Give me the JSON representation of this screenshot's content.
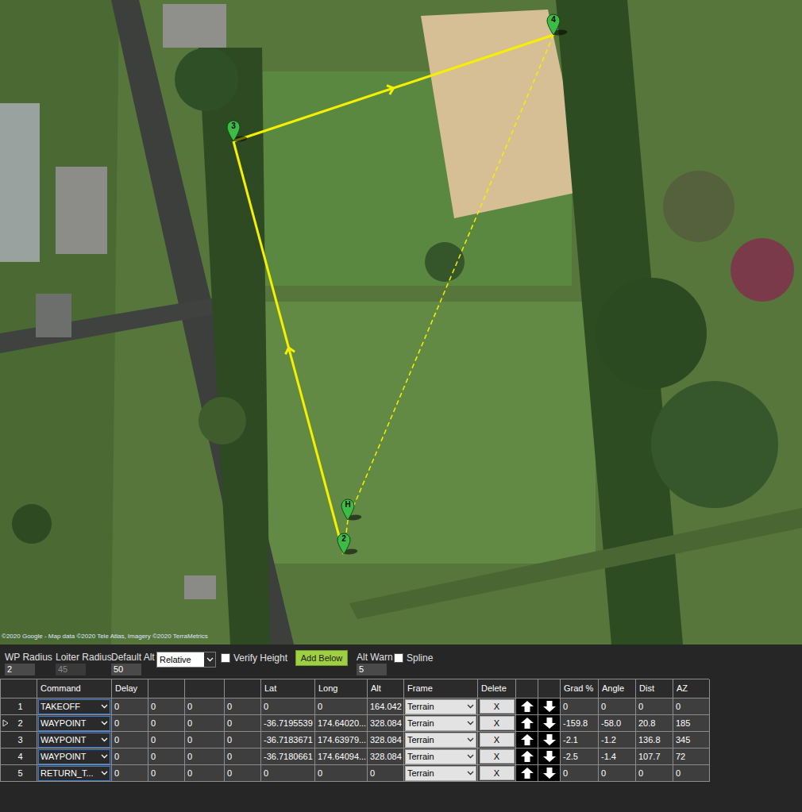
{
  "map": {
    "attribution": "©2020 Google - Map data ©2020 Tele Atlas, Imagery ©2020 TerraMetrics",
    "waypoints": [
      {
        "label": "H"
      },
      {
        "label": "2"
      },
      {
        "label": "3"
      },
      {
        "label": "4"
      }
    ],
    "route": [
      {
        "from": "2",
        "to": "3",
        "kind": "solid"
      },
      {
        "from": "3",
        "to": "4",
        "kind": "solid"
      },
      {
        "from": "4",
        "to": "H",
        "kind": "dashed"
      },
      {
        "from": "H",
        "to": "2",
        "kind": "dashed"
      }
    ]
  },
  "controls": {
    "wp_radius": {
      "label": "WP Radius",
      "value": "2",
      "disabled": false
    },
    "loiter_radius": {
      "label": "Loiter Radius",
      "value": "45",
      "disabled": true
    },
    "default_alt": {
      "label": "Default Alt",
      "value": "50",
      "disabled": false
    },
    "alt_frame": {
      "value": "Relative"
    },
    "verify_height": {
      "label": "Verify Height",
      "checked": false
    },
    "add_below": "Add Below",
    "alt_warn": {
      "label": "Alt Warn",
      "value": "5",
      "disabled": false
    },
    "spline": {
      "label": "Spline",
      "checked": false
    }
  },
  "table": {
    "columns": [
      "",
      "Command",
      "Delay",
      "",
      "",
      "",
      "Lat",
      "Long",
      "Alt",
      "Frame",
      "Delete",
      "",
      "",
      "Grad %",
      "Angle",
      "Dist",
      "AZ"
    ],
    "rows": [
      {
        "num": "1",
        "current": false,
        "cells": [
          "TAKEOFF",
          "0",
          "0",
          "0",
          "0",
          "0",
          "0",
          "164.042",
          "Terrain",
          "X",
          "0",
          "0",
          "0",
          "0"
        ]
      },
      {
        "num": "2",
        "current": true,
        "cells": [
          "WAYPOINT",
          "0",
          "0",
          "0",
          "0",
          "-36.7195539",
          "174.64020...",
          "328.084",
          "Terrain",
          "X",
          "-159.8",
          "-58.0",
          "20.8",
          "185"
        ]
      },
      {
        "num": "3",
        "current": false,
        "cells": [
          "WAYPOINT",
          "0",
          "0",
          "0",
          "0",
          "-36.7183671",
          "174.63979...",
          "328.084",
          "Terrain",
          "X",
          "-2.1",
          "-1.2",
          "136.8",
          "345"
        ]
      },
      {
        "num": "4",
        "current": false,
        "cells": [
          "WAYPOINT",
          "0",
          "0",
          "0",
          "0",
          "-36.7180661",
          "174.64094...",
          "328.084",
          "Terrain",
          "X",
          "-2.5",
          "-1.4",
          "107.7",
          "72"
        ]
      },
      {
        "num": "5",
        "current": false,
        "cells": [
          "RETURN_T...",
          "0",
          "0",
          "0",
          "0",
          "0",
          "0",
          "0",
          "Terrain",
          "X",
          "0",
          "0",
          "0",
          "0"
        ]
      }
    ]
  }
}
